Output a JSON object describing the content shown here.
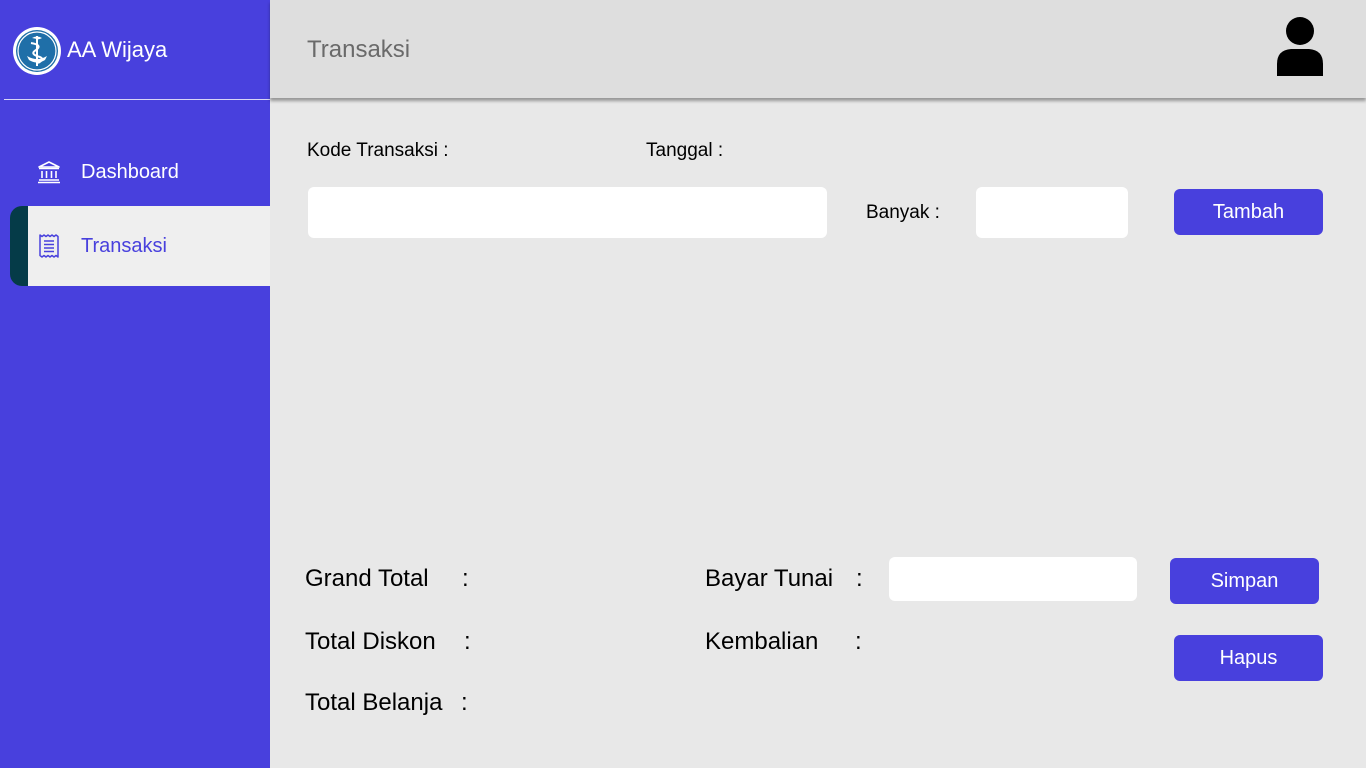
{
  "sidebar": {
    "brand_name": "AA Wijaya",
    "brand_icon": "caduceus-icon",
    "items": [
      {
        "label": "Dashboard",
        "icon": "bank-icon",
        "active": false
      },
      {
        "label": "Transaksi",
        "icon": "receipt-icon",
        "active": true
      }
    ]
  },
  "header": {
    "title": "Transaksi",
    "user_icon": "user-icon"
  },
  "form": {
    "kode_label": "Kode Transaksi :",
    "tanggal_label": "Tanggal :",
    "kode_value": "",
    "banyak_label": "Banyak :",
    "banyak_value": "",
    "tambah_label": "Tambah"
  },
  "summary": {
    "grand_total_label": "Grand Total",
    "total_diskon_label": "Total Diskon",
    "total_belanja_label": "Total Belanja",
    "bayar_tunai_label": "Bayar Tunai",
    "kembalian_label": "Kembalian",
    "colon": ":",
    "bayar_value": "",
    "simpan_label": "Simpan",
    "hapus_label": "Hapus"
  },
  "colors": {
    "primary": "#4840dd",
    "active_marker": "#053b48",
    "header_bg": "#dedede",
    "content_bg": "#e8e8e8"
  }
}
